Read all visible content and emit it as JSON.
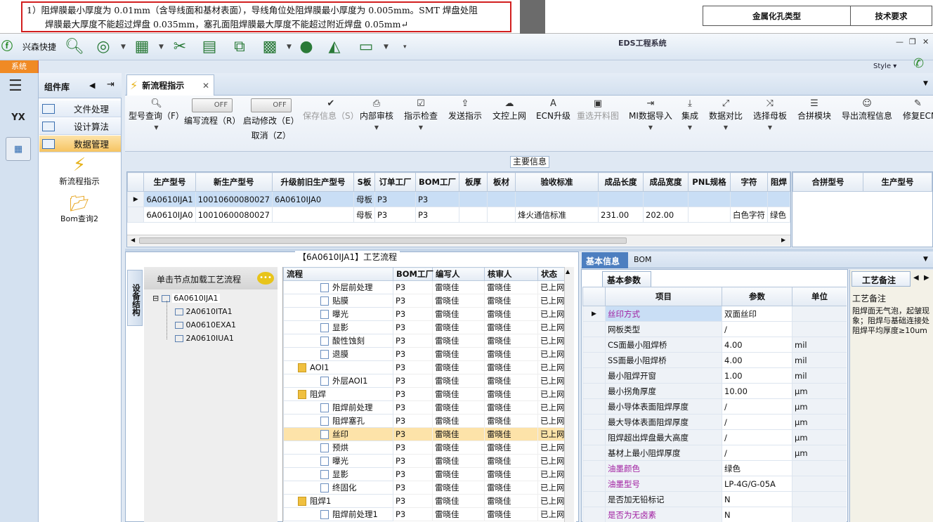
{
  "doc": {
    "line1": "1）阻焊膜最小厚度为 0.01mm（含导线面和基材表面），导线角位处阻焊膜最小厚度为 0.005mm。SMT 焊盘处阻",
    "line2": "焊膜最大厚度不能超过焊盘 0.035mm，塞孔面阻焊膜最大厚度不能超过附近焊盘 0.05mm↵",
    "table_col1": "金属化孔类型",
    "table_col2": "技术要求"
  },
  "app": {
    "name": "兴森快捷",
    "window_title": "EDS工程系统",
    "style_label": "Style",
    "system_tab": "系统"
  },
  "component_lib": {
    "title": "组件库",
    "menu": [
      {
        "label": "文件处理"
      },
      {
        "label": "设计算法"
      },
      {
        "label": "数据管理"
      }
    ],
    "items": [
      {
        "label": "新流程指示"
      },
      {
        "label": "Bom查询2"
      }
    ]
  },
  "tab": {
    "label": "新流程指示"
  },
  "ribbon": [
    {
      "label": "型号查询（F）",
      "icon": "search-icon"
    },
    {
      "label": "编写流程（R）",
      "toggle": "OFF"
    },
    {
      "label": "启动修改（E）",
      "toggle": "OFF",
      "sub": "取消（Z）"
    },
    {
      "label": "保存信息（S）",
      "icon": "check-icon"
    },
    {
      "label": "内部审核",
      "icon": "print-icon"
    },
    {
      "label": "指示检查",
      "icon": "checkbox-icon"
    },
    {
      "label": "发送指示",
      "icon": "upload-icon"
    },
    {
      "label": "文控上网",
      "icon": "cloud-upload-icon"
    },
    {
      "label": "ECN升级",
      "icon": "a-icon"
    },
    {
      "label": "重选开料图",
      "icon": "image-icon"
    },
    {
      "label": "MI数据导入",
      "icon": "import-icon"
    },
    {
      "label": "集成",
      "icon": "download-icon"
    },
    {
      "label": "数据对比",
      "icon": "compare-icon"
    },
    {
      "label": "选择母板",
      "icon": "shuffle-icon"
    },
    {
      "label": "合拼模块",
      "icon": "list-icon"
    },
    {
      "label": "导出流程信息",
      "icon": "smiley-icon"
    },
    {
      "label": "修复ECN",
      "icon": "wrench-icon"
    }
  ],
  "main_info": {
    "section_label": "主要信息",
    "columns": [
      "生产型号",
      "新生产型号",
      "升级前旧生产型号",
      "S板",
      "订单工厂",
      "BOM工厂",
      "板厚",
      "板材",
      "验收标准",
      "成品长度",
      "成品宽度",
      "PNL规格",
      "字符",
      "阻焊"
    ],
    "rows": [
      [
        "6A0610IJA1",
        "10010600080027",
        "6A0610IJA0",
        "母板",
        "P3",
        "P3",
        "",
        "",
        "",
        "",
        "",
        "",
        "",
        ""
      ],
      [
        "6A0610IJA0",
        "10010600080027",
        "",
        "母板",
        "P3",
        "P3",
        "",
        "",
        "烽火通信标准",
        "231.00",
        "202.00",
        "",
        "白色字符",
        "绿色"
      ]
    ],
    "right_columns": [
      "合拼型号",
      "生产型号"
    ]
  },
  "flow": {
    "title": "【6A0610IJA1】工艺流程",
    "vertical_tab": "设备结构",
    "tree_header": "单击节点加载工艺流程",
    "tree": [
      "6A0610IJA1",
      "2A0610ITA1",
      "0A0610EXA1",
      "2A0610IUA1"
    ],
    "columns": [
      "流程",
      "BOM工厂",
      "编写人",
      "核审人",
      "状态"
    ],
    "rows": [
      {
        "name": "外层前处理",
        "level": 2,
        "bom": "P3",
        "writer": "雷晓佳",
        "reviewer": "雷晓佳",
        "status": "已上网"
      },
      {
        "name": "贴膜",
        "level": 2,
        "bom": "P3",
        "writer": "雷晓佳",
        "reviewer": "雷晓佳",
        "status": "已上网"
      },
      {
        "name": "曝光",
        "level": 2,
        "bom": "P3",
        "writer": "雷晓佳",
        "reviewer": "雷晓佳",
        "status": "已上网"
      },
      {
        "name": "显影",
        "level": 2,
        "bom": "P3",
        "writer": "雷晓佳",
        "reviewer": "雷晓佳",
        "status": "已上网"
      },
      {
        "name": "酸性蚀刻",
        "level": 2,
        "bom": "P3",
        "writer": "雷晓佳",
        "reviewer": "雷晓佳",
        "status": "已上网"
      },
      {
        "name": "退膜",
        "level": 2,
        "bom": "P3",
        "writer": "雷晓佳",
        "reviewer": "雷晓佳",
        "status": "已上网"
      },
      {
        "name": "AOI1",
        "level": 1,
        "bom": "P3",
        "writer": "雷晓佳",
        "reviewer": "雷晓佳",
        "status": "已上网"
      },
      {
        "name": "外层AOI1",
        "level": 2,
        "bom": "P3",
        "writer": "雷晓佳",
        "reviewer": "雷晓佳",
        "status": "已上网"
      },
      {
        "name": "阻焊",
        "level": 1,
        "bom": "P3",
        "writer": "雷晓佳",
        "reviewer": "雷晓佳",
        "status": "已上网"
      },
      {
        "name": "阻焊前处理",
        "level": 2,
        "bom": "P3",
        "writer": "雷晓佳",
        "reviewer": "雷晓佳",
        "status": "已上网"
      },
      {
        "name": "阻焊塞孔",
        "level": 2,
        "bom": "P3",
        "writer": "雷晓佳",
        "reviewer": "雷晓佳",
        "status": "已上网"
      },
      {
        "name": "丝印",
        "level": 2,
        "bom": "P3",
        "writer": "雷晓佳",
        "reviewer": "雷晓佳",
        "status": "已上网",
        "selected": true
      },
      {
        "name": "预烘",
        "level": 2,
        "bom": "P3",
        "writer": "雷晓佳",
        "reviewer": "雷晓佳",
        "status": "已上网"
      },
      {
        "name": "曝光",
        "level": 2,
        "bom": "P3",
        "writer": "雷晓佳",
        "reviewer": "雷晓佳",
        "status": "已上网"
      },
      {
        "name": "显影",
        "level": 2,
        "bom": "P3",
        "writer": "雷晓佳",
        "reviewer": "雷晓佳",
        "status": "已上网"
      },
      {
        "name": "终固化",
        "level": 2,
        "bom": "P3",
        "writer": "雷晓佳",
        "reviewer": "雷晓佳",
        "status": "已上网"
      },
      {
        "name": "阻焊1",
        "level": 1,
        "bom": "P3",
        "writer": "雷晓佳",
        "reviewer": "雷晓佳",
        "status": "已上网"
      },
      {
        "name": "阻焊前处理1",
        "level": 2,
        "bom": "P3",
        "writer": "雷晓佳",
        "reviewer": "雷晓佳",
        "status": "已上网"
      }
    ]
  },
  "basic_info": {
    "tabs": [
      "基本信息",
      "BOM"
    ],
    "sub_tab": "基本参数",
    "columns": [
      "项目",
      "参数",
      "单位"
    ],
    "rows": [
      {
        "item": "丝印方式",
        "value": "双面丝印",
        "unit": "",
        "highlight": true
      },
      {
        "item": "网板类型",
        "value": "/",
        "unit": ""
      },
      {
        "item": "CS面最小阻焊桥",
        "value": "4.00",
        "unit": "mil"
      },
      {
        "item": "SS面最小阻焊桥",
        "value": "4.00",
        "unit": "mil"
      },
      {
        "item": "最小阻焊开窗",
        "value": "1.00",
        "unit": "mil"
      },
      {
        "item": "最小拐角厚度",
        "value": "10.00",
        "unit": "μm"
      },
      {
        "item": "最小导体表面阻焊厚度",
        "value": "/",
        "unit": "μm"
      },
      {
        "item": "最大导体表面阻焊厚度",
        "value": "/",
        "unit": "μm"
      },
      {
        "item": "阻焊超出焊盘最大高度",
        "value": "/",
        "unit": "μm"
      },
      {
        "item": "基材上最小阻焊厚度",
        "value": "/",
        "unit": "μm"
      },
      {
        "item": "油墨颜色",
        "value": "绿色",
        "unit": "",
        "highlight": true
      },
      {
        "item": "油墨型号",
        "value": "LP-4G/G-05A",
        "unit": "",
        "highlight": true
      },
      {
        "item": "是否加无铅标记",
        "value": "N",
        "unit": ""
      },
      {
        "item": "是否为无卤素",
        "value": "N",
        "unit": "",
        "highlight": true
      }
    ]
  },
  "memo": {
    "tab": "工艺备注",
    "label": "工艺备注",
    "text": "阻焊面无气泡，起皱现象；阻焊与基础连接处阻焊平均厚度≥10um"
  },
  "colors": {
    "accent": "#f08a24",
    "selection": "#c9def5",
    "highlight_row": "#fde3a9"
  }
}
